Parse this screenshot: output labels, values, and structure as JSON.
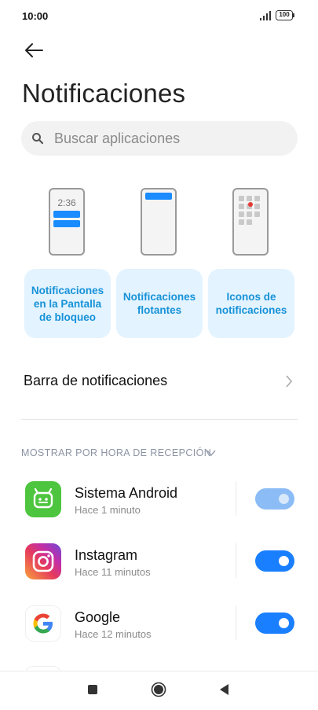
{
  "status_bar": {
    "time": "10:00",
    "battery": "100"
  },
  "header": {
    "title": "Notificaciones"
  },
  "search": {
    "placeholder": "Buscar aplicaciones"
  },
  "illustration": {
    "lockscreen_time": "2:36"
  },
  "cards": [
    {
      "label": "Notificaciones en la Pantalla de bloqueo"
    },
    {
      "label": "Notificaciones flotantes"
    },
    {
      "label": "Iconos de notificaciones"
    }
  ],
  "notification_bar": {
    "label": "Barra de notificaciones"
  },
  "sort": {
    "label": "MOSTRAR POR HORA DE RECEPCIÓN"
  },
  "apps": [
    {
      "name": "Sistema Android",
      "time": "Hace 1 minuto",
      "enabled": true,
      "toggle_disabled": true,
      "icon": "android-icon",
      "icon_color": "#4ec53f"
    },
    {
      "name": "Instagram",
      "time": "Hace 11 minutos",
      "enabled": true,
      "toggle_disabled": false,
      "icon": "instagram-icon",
      "icon_color": "#d6249f"
    },
    {
      "name": "Google",
      "time": "Hace 12 minutos",
      "enabled": true,
      "toggle_disabled": false,
      "icon": "google-icon",
      "icon_color": "#4285f4"
    }
  ],
  "colors": {
    "accent": "#1a7fff",
    "card_bg": "#e3f3ff",
    "card_text": "#1692d8"
  }
}
